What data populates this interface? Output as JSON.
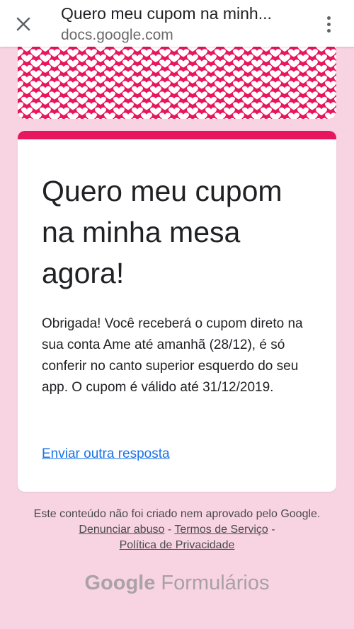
{
  "browser": {
    "title": "Quero meu cupom na minh...",
    "url": "docs.google.com",
    "close_icon": "close-icon",
    "menu_icon": "more-vert-icon"
  },
  "colors": {
    "page_background": "#f8d4e3",
    "accent": "#e8175d",
    "link": "#1a73e8"
  },
  "form": {
    "title": "Quero meu cupom na minha mesa agora!",
    "confirmation_message": "Obrigada! Você receberá o cupom direto na sua conta Ame até amanhã (28/12), é só conferir no canto superior esquerdo do seu app. O cupom é válido até 31/12/2019.",
    "resubmit_link": "Enviar outra resposta"
  },
  "footer": {
    "disclaimer": "Este conteúdo não foi criado nem aprovado pelo Google.",
    "report_abuse": "Denunciar abuso",
    "separator": "-",
    "terms": "Termos de Serviço",
    "privacy": "Política de Privacidade",
    "brand_google": "Google",
    "brand_product": "Formulários"
  }
}
